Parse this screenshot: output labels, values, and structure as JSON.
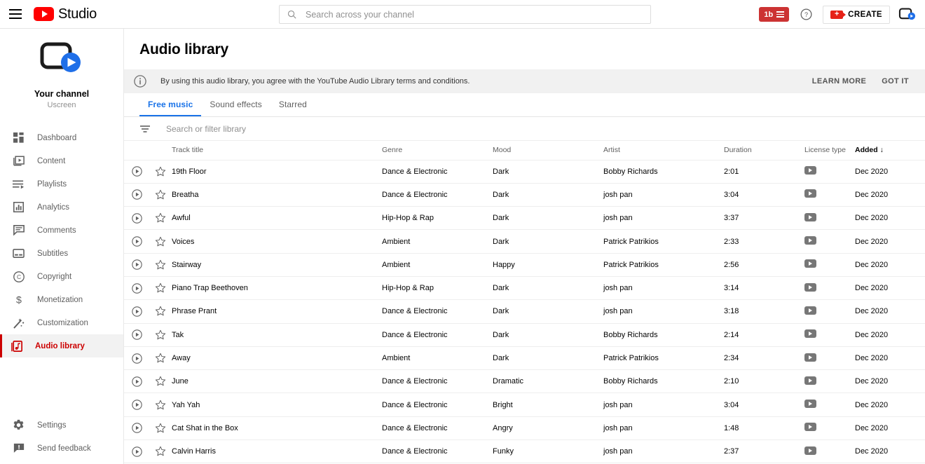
{
  "topbar": {
    "menu_icon": "hamburger-icon",
    "brand": "Studio",
    "search_placeholder": "Search across your channel",
    "search_value": "",
    "pending_badge": "1b",
    "help_icon": "help-circle-icon",
    "create_label": "CREATE",
    "avatar_icon": "channel-avatar-icon"
  },
  "sidebar": {
    "channel_label": "Your channel",
    "channel_name": "Uscreen",
    "items": [
      {
        "label": "Dashboard",
        "icon": "dashboard-icon",
        "active": false
      },
      {
        "label": "Content",
        "icon": "content-icon",
        "active": false
      },
      {
        "label": "Playlists",
        "icon": "playlists-icon",
        "active": false
      },
      {
        "label": "Analytics",
        "icon": "analytics-icon",
        "active": false
      },
      {
        "label": "Comments",
        "icon": "comments-icon",
        "active": false
      },
      {
        "label": "Subtitles",
        "icon": "subtitles-icon",
        "active": false
      },
      {
        "label": "Copyright",
        "icon": "copyright-icon",
        "active": false
      },
      {
        "label": "Monetization",
        "icon": "dollar-icon",
        "active": false
      },
      {
        "label": "Customization",
        "icon": "magic-wand-icon",
        "active": false
      },
      {
        "label": "Audio library",
        "icon": "audio-library-icon",
        "active": true
      }
    ],
    "bottom_items": [
      {
        "label": "Settings",
        "icon": "gear-icon"
      },
      {
        "label": "Send feedback",
        "icon": "feedback-icon"
      }
    ],
    "active_color": "#cc0000"
  },
  "main": {
    "page_title": "Audio library",
    "notice": {
      "icon": "info-icon",
      "text": "By using this audio library, you agree with the YouTube Audio Library terms and conditions.",
      "learn_more": "LEARN MORE",
      "got_it": "GOT IT"
    },
    "tabs": [
      {
        "label": "Free music",
        "active": true
      },
      {
        "label": "Sound effects",
        "active": false
      },
      {
        "label": "Starred",
        "active": false
      }
    ],
    "tab_accent": "#1a73e8",
    "filter": {
      "icon": "filter-icon",
      "placeholder": "Search or filter library",
      "value": ""
    },
    "table": {
      "headers": {
        "track_title": "Track title",
        "genre": "Genre",
        "mood": "Mood",
        "artist": "Artist",
        "duration": "Duration",
        "license_type": "License type",
        "added": "Added",
        "sort_arrow": "↓",
        "sorted_column": "Added"
      },
      "row_icons": {
        "play": "play-circle-icon",
        "star": "star-outline-icon",
        "license": "youtube-license-icon"
      },
      "rows": [
        {
          "title": "19th Floor",
          "genre": "Dance & Electronic",
          "mood": "Dark",
          "artist": "Bobby Richards",
          "duration": "2:01",
          "added": "Dec 2020"
        },
        {
          "title": "Breatha",
          "genre": "Dance & Electronic",
          "mood": "Dark",
          "artist": "josh pan",
          "duration": "3:04",
          "added": "Dec 2020"
        },
        {
          "title": "Awful",
          "genre": "Hip-Hop & Rap",
          "mood": "Dark",
          "artist": "josh pan",
          "duration": "3:37",
          "added": "Dec 2020"
        },
        {
          "title": "Voices",
          "genre": "Ambient",
          "mood": "Dark",
          "artist": "Patrick Patrikios",
          "duration": "2:33",
          "added": "Dec 2020"
        },
        {
          "title": "Stairway",
          "genre": "Ambient",
          "mood": "Happy",
          "artist": "Patrick Patrikios",
          "duration": "2:56",
          "added": "Dec 2020"
        },
        {
          "title": "Piano Trap Beethoven",
          "genre": "Hip-Hop & Rap",
          "mood": "Dark",
          "artist": "josh pan",
          "duration": "3:14",
          "added": "Dec 2020"
        },
        {
          "title": "Phrase Prant",
          "genre": "Dance & Electronic",
          "mood": "Dark",
          "artist": "josh pan",
          "duration": "3:18",
          "added": "Dec 2020"
        },
        {
          "title": "Tak",
          "genre": "Dance & Electronic",
          "mood": "Dark",
          "artist": "Bobby Richards",
          "duration": "2:14",
          "added": "Dec 2020"
        },
        {
          "title": "Away",
          "genre": "Ambient",
          "mood": "Dark",
          "artist": "Patrick Patrikios",
          "duration": "2:34",
          "added": "Dec 2020"
        },
        {
          "title": "June",
          "genre": "Dance & Electronic",
          "mood": "Dramatic",
          "artist": "Bobby Richards",
          "duration": "2:10",
          "added": "Dec 2020"
        },
        {
          "title": "Yah Yah",
          "genre": "Dance & Electronic",
          "mood": "Bright",
          "artist": "josh pan",
          "duration": "3:04",
          "added": "Dec 2020"
        },
        {
          "title": "Cat Shat in the Box",
          "genre": "Dance & Electronic",
          "mood": "Angry",
          "artist": "josh pan",
          "duration": "1:48",
          "added": "Dec 2020"
        },
        {
          "title": "Calvin Harris",
          "genre": "Dance & Electronic",
          "mood": "Funky",
          "artist": "josh pan",
          "duration": "2:37",
          "added": "Dec 2020"
        }
      ]
    }
  }
}
